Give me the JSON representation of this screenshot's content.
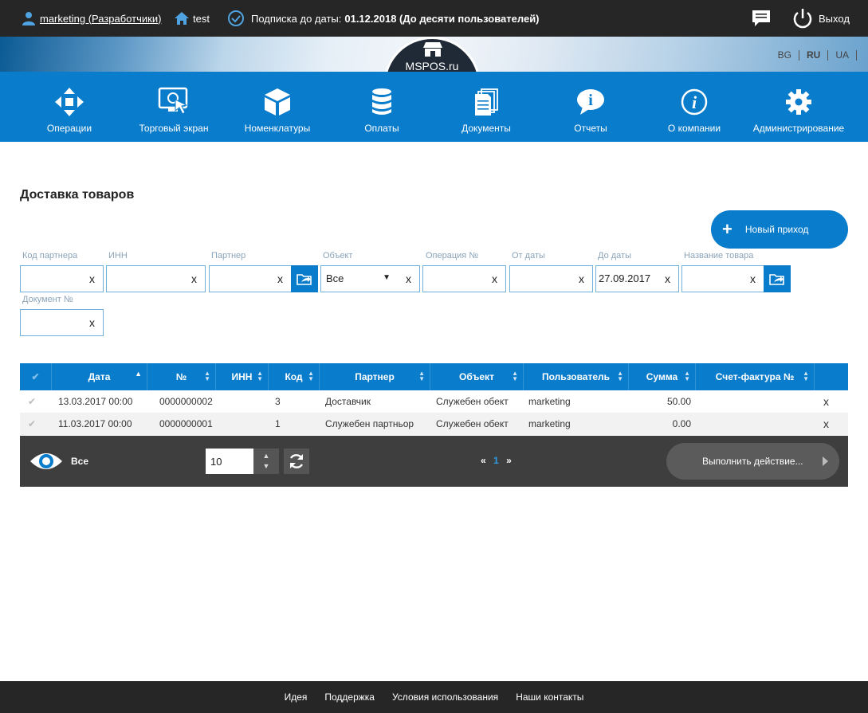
{
  "topbar": {
    "user_link": "marketing (Разработчики)",
    "home_label": "test",
    "subscription_prefix": "Подписка до даты:",
    "subscription_value": "01.12.2018 (До десяти пользователей)",
    "logout_label": "Выход"
  },
  "banner": {
    "logo_text": "MSPOS.ru",
    "languages": [
      "BG",
      "RU",
      "UA"
    ],
    "active_language": "RU"
  },
  "nav": [
    {
      "label": "Операции",
      "icon": "arrows-move-icon"
    },
    {
      "label": "Торговый экран",
      "icon": "touch-screen-icon"
    },
    {
      "label": "Номенклатуры",
      "icon": "cube-icon"
    },
    {
      "label": "Оплаты",
      "icon": "database-stack-icon"
    },
    {
      "label": "Документы",
      "icon": "documents-icon"
    },
    {
      "label": "Отчеты",
      "icon": "info-bubble-icon"
    },
    {
      "label": "О компании",
      "icon": "info-circle-icon"
    },
    {
      "label": "Администрирование",
      "icon": "gear-icon"
    }
  ],
  "page": {
    "title": "Доставка товаров",
    "new_button": "Новый приход"
  },
  "filters": {
    "partner_code": {
      "label": "Код партнера",
      "value": ""
    },
    "inn": {
      "label": "ИНН",
      "value": ""
    },
    "partner": {
      "label": "Партнер",
      "value": ""
    },
    "object": {
      "label": "Объект",
      "value": "Все"
    },
    "operation_no": {
      "label": "Операция №",
      "value": ""
    },
    "from_date": {
      "label": "От даты",
      "value": ""
    },
    "to_date": {
      "label": "До даты",
      "value": "27.09.2017"
    },
    "product_name": {
      "label": "Название товара",
      "value": ""
    },
    "document_no": {
      "label": "Документ №",
      "value": ""
    },
    "clear_glyph": "x"
  },
  "table": {
    "columns": [
      "Дата",
      "№",
      "ИНН",
      "Код",
      "Партнер",
      "Объект",
      "Пользователь",
      "Сумма",
      "Счет-фактура №"
    ],
    "rows": [
      {
        "date": "13.03.2017 00:00",
        "number": "0000000002",
        "inn": "",
        "code": "3",
        "partner": "Доставчик",
        "object": "Служебен обект",
        "user": "marketing",
        "sum": "50.00",
        "invoice": ""
      },
      {
        "date": "11.03.2017 00:00",
        "number": "0000000001",
        "inn": "",
        "code": "1",
        "partner": "Служебен партньор",
        "object": "Служебен обект",
        "user": "marketing",
        "sum": "0.00",
        "invoice": ""
      }
    ],
    "delete_glyph": "x"
  },
  "table_footer": {
    "view_label": "Все",
    "page_size": "10",
    "pagination": {
      "prev": "«",
      "current": "1",
      "next": "»"
    },
    "action_button": "Выполнить действие..."
  },
  "footer": {
    "links": [
      "Идея",
      "Поддержка",
      "Условия использования",
      "Наши контакты"
    ]
  },
  "colors": {
    "topbar": "#262626",
    "nav": "#0a7ccc",
    "table_footer": "#3e3e3e"
  }
}
